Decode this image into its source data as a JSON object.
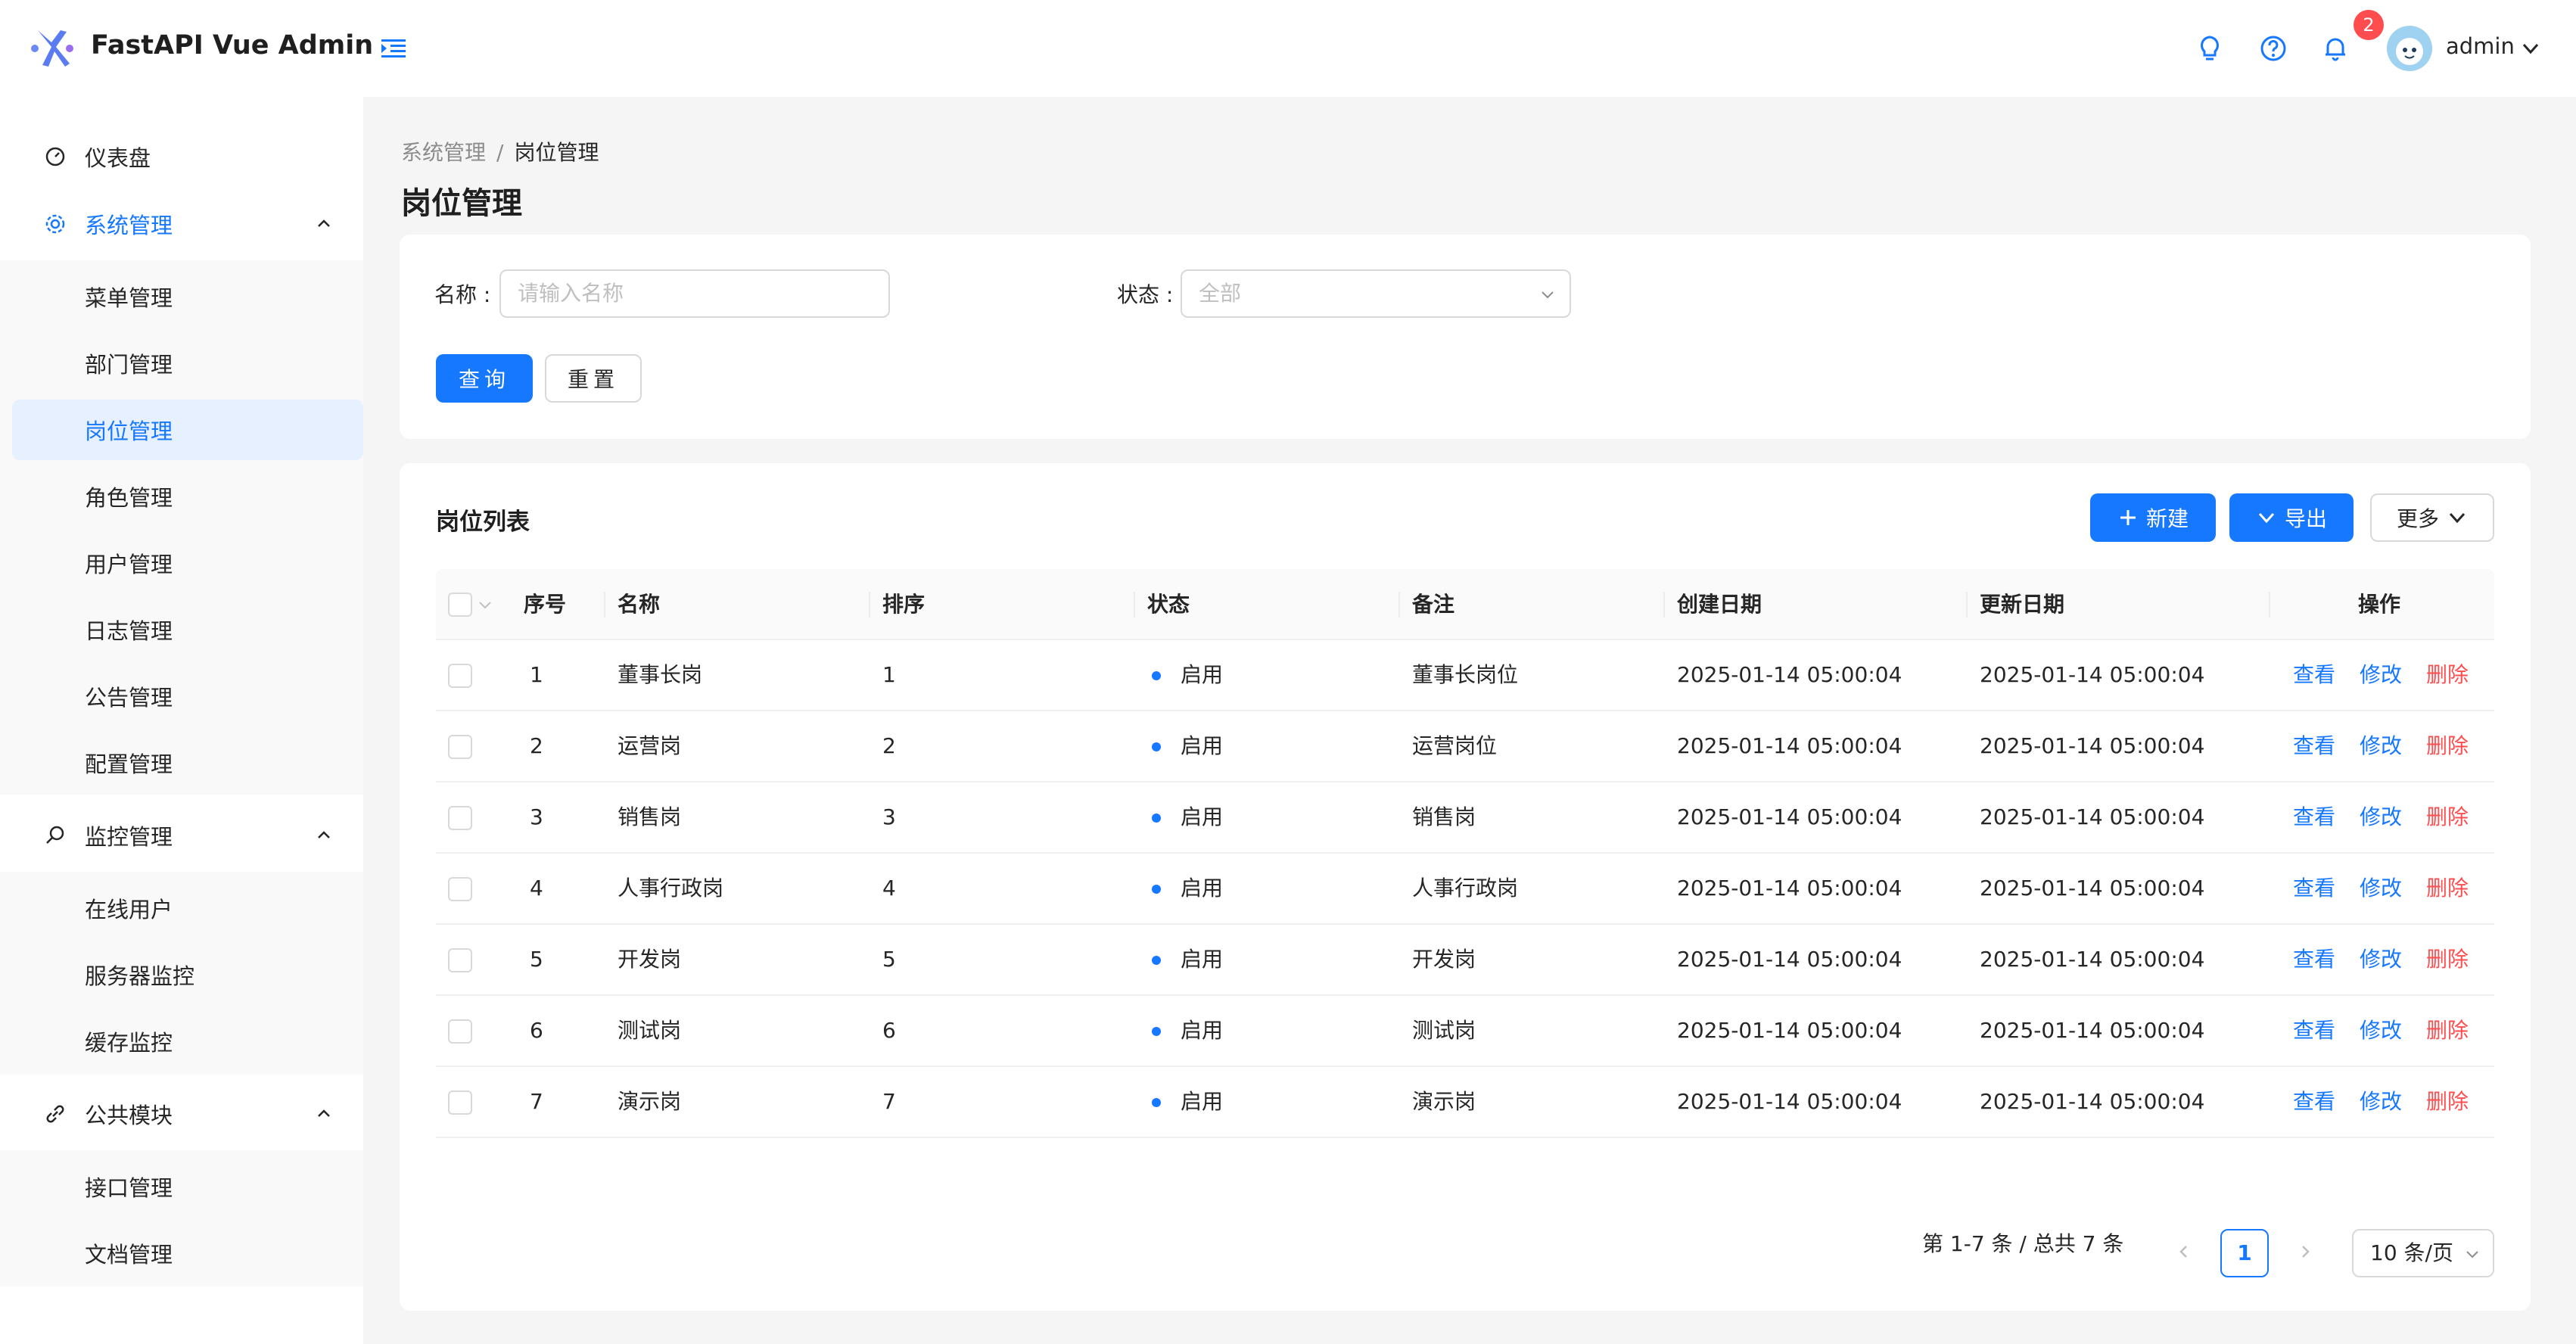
{
  "app": {
    "title": "FastAPI Vue Admin"
  },
  "header": {
    "notification_count": "2",
    "username": "admin",
    "icons": [
      "menu-fold-icon",
      "bulb-icon",
      "question-icon",
      "bell-icon",
      "chevron-down-icon"
    ]
  },
  "sidebar": {
    "dashboard": "仪表盘",
    "system": {
      "label": "系统管理",
      "items": [
        "菜单管理",
        "部门管理",
        "岗位管理",
        "角色管理",
        "用户管理",
        "日志管理",
        "公告管理",
        "配置管理"
      ],
      "active": "岗位管理"
    },
    "monitor": {
      "label": "监控管理",
      "items": [
        "在线用户",
        "服务器监控",
        "缓存监控"
      ]
    },
    "common": {
      "label": "公共模块",
      "items": [
        "接口管理",
        "文档管理"
      ]
    }
  },
  "breadcrumb": {
    "parent": "系统管理",
    "sep": "/",
    "current": "岗位管理"
  },
  "page_title": "岗位管理",
  "search": {
    "name_label": "名称 :",
    "name_placeholder": "请输入名称",
    "status_label": "状态 :",
    "status_value": "全部",
    "query_label": "查询",
    "reset_label": "重置"
  },
  "list": {
    "title": "岗位列表",
    "new_label": "新建",
    "export_label": "导出",
    "more_label": "更多",
    "columns": [
      "序号",
      "名称",
      "排序",
      "状态",
      "备注",
      "创建日期",
      "更新日期",
      "操作"
    ],
    "rows": [
      {
        "idx": "1",
        "name": "董事长岗",
        "order": "1",
        "status": "启用",
        "remark": "董事长岗位",
        "created": "2025-01-14 05:00:04",
        "updated": "2025-01-14 05:00:04"
      },
      {
        "idx": "2",
        "name": "运营岗",
        "order": "2",
        "status": "启用",
        "remark": "运营岗位",
        "created": "2025-01-14 05:00:04",
        "updated": "2025-01-14 05:00:04"
      },
      {
        "idx": "3",
        "name": "销售岗",
        "order": "3",
        "status": "启用",
        "remark": "销售岗",
        "created": "2025-01-14 05:00:04",
        "updated": "2025-01-14 05:00:04"
      },
      {
        "idx": "4",
        "name": "人事行政岗",
        "order": "4",
        "status": "启用",
        "remark": "人事行政岗",
        "created": "2025-01-14 05:00:04",
        "updated": "2025-01-14 05:00:04"
      },
      {
        "idx": "5",
        "name": "开发岗",
        "order": "5",
        "status": "启用",
        "remark": "开发岗",
        "created": "2025-01-14 05:00:04",
        "updated": "2025-01-14 05:00:04"
      },
      {
        "idx": "6",
        "name": "测试岗",
        "order": "6",
        "status": "启用",
        "remark": "测试岗",
        "created": "2025-01-14 05:00:04",
        "updated": "2025-01-14 05:00:04"
      },
      {
        "idx": "7",
        "name": "演示岗",
        "order": "7",
        "status": "启用",
        "remark": "演示岗",
        "created": "2025-01-14 05:00:04",
        "updated": "2025-01-14 05:00:04"
      }
    ],
    "actions": {
      "view": "查看",
      "edit": "修改",
      "delete": "删除"
    }
  },
  "pagination": {
    "summary": "第 1-7 条 / 总共 7 条",
    "current_page": "1",
    "page_size": "10 条/页"
  },
  "colors": {
    "primary": "#1677ff",
    "danger": "#ff4d4f",
    "badge": "#ff4d4f"
  }
}
